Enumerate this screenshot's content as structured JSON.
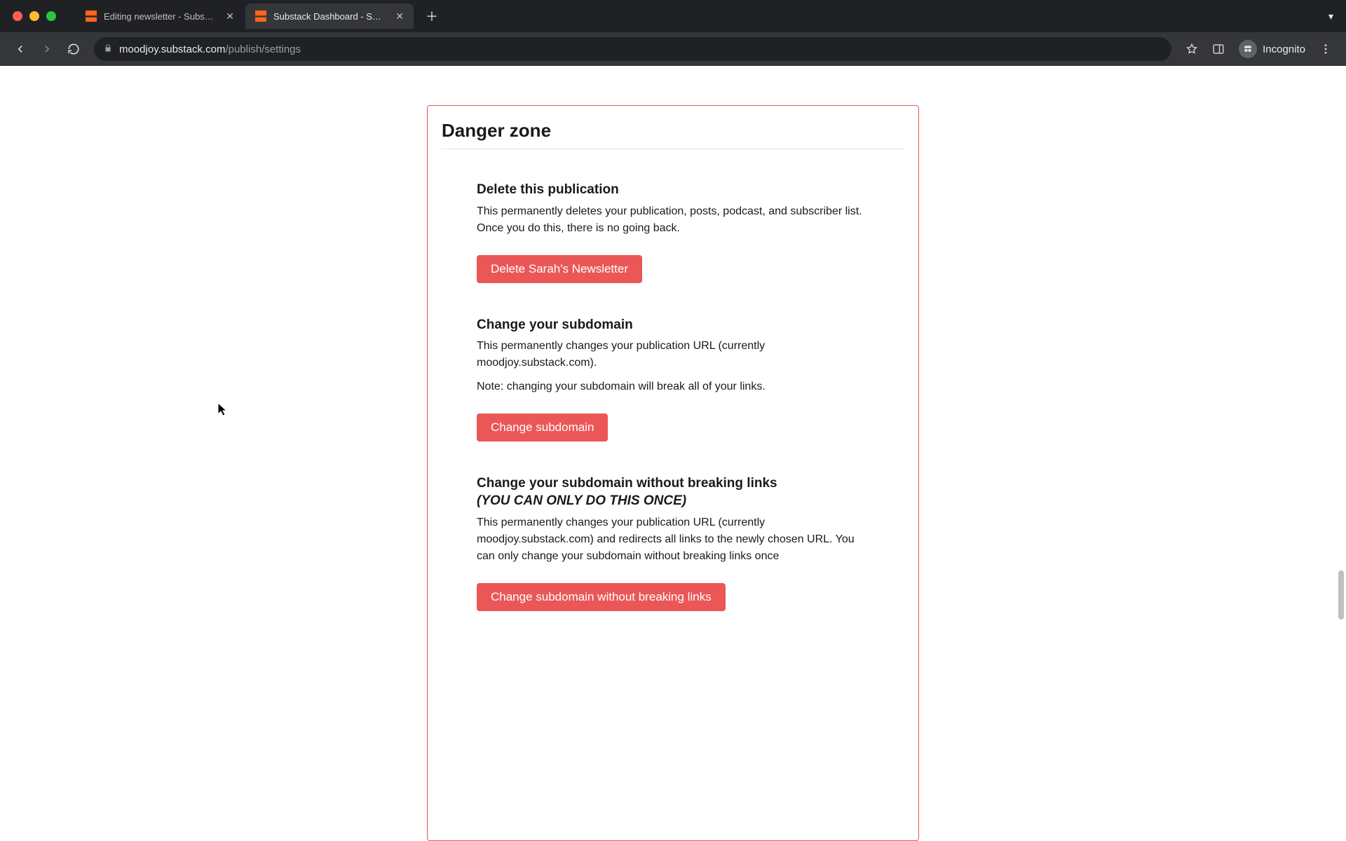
{
  "chrome": {
    "tabs": [
      {
        "title": "Editing newsletter - Substack",
        "active": false
      },
      {
        "title": "Substack Dashboard - Sarah's",
        "active": true
      }
    ],
    "url_host": "moodjoy.substack.com",
    "url_path": "/publish/settings",
    "incognito_label": "Incognito"
  },
  "page": {
    "heading": "Danger zone",
    "sections": [
      {
        "title": "Delete this publication",
        "desc1": "This permanently deletes your publication, posts, podcast, and subscriber list. Once you do this, there is no going back.",
        "button": "Delete Sarah's Newsletter"
      },
      {
        "title": "Change your subdomain",
        "desc1": "This permanently changes your publication URL (currently moodjoy.substack.com).",
        "desc2": "Note: changing your subdomain will break all of your links.",
        "button": "Change subdomain"
      },
      {
        "title": "Change your subdomain without breaking links",
        "title_ital": "(YOU CAN ONLY DO THIS ONCE)",
        "desc1": "This permanently changes your publication URL (currently moodjoy.substack.com) and redirects all links to the newly chosen URL. You can only change your subdomain without breaking links once",
        "button": "Change subdomain without breaking links"
      }
    ]
  }
}
